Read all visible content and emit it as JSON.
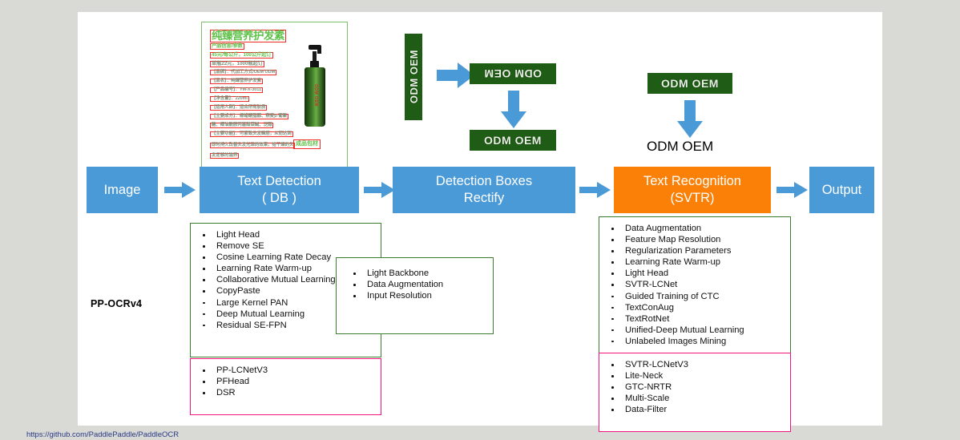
{
  "slide": {
    "pipeline_label": "PP-OCRv4",
    "stages": [
      {
        "id": "image",
        "label_line1": "Image",
        "label_line2": "",
        "color": "#4a9ad7"
      },
      {
        "id": "detection",
        "label_line1": "Text Detection",
        "label_line2": "( DB )",
        "color": "#4a9ad7"
      },
      {
        "id": "rectify",
        "label_line1": "Detection Boxes",
        "label_line2": "Rectify",
        "color": "#4a9ad7"
      },
      {
        "id": "recognition",
        "label_line1": "Text Recognition",
        "label_line2": "(SVTR)",
        "color": "#fa8008"
      },
      {
        "id": "output",
        "label_line1": "Output",
        "label_line2": "",
        "color": "#4a9ad7"
      }
    ],
    "detection_features": {
      "border_color": "#3a7d2c",
      "items": [
        "Light Head",
        "Remove SE",
        "Cosine Learning Rate Decay",
        "Learning Rate Warm-up",
        "Collaborative Mutual Learning",
        "CopyPaste",
        "Large Kernel PAN",
        "Deep Mutual Learning",
        "Residual SE-FPN"
      ]
    },
    "detection_new": {
      "border_color": "#f5147f",
      "items": [
        "PP-LCNetV3",
        "PFHead",
        "DSR"
      ]
    },
    "rectify_features": {
      "border_color": "#3a7d2c",
      "items": [
        "Light Backbone",
        "Data Augmentation",
        "Input Resolution"
      ]
    },
    "recognition_features": {
      "border_color": "#3a7d2c",
      "items": [
        "Data Augmentation",
        "Feature Map Resolution",
        "Regularization Parameters",
        "Learning Rate Warm-up",
        "Light Head",
        "SVTR-LCNet",
        "Guided Training of CTC",
        "TextConAug",
        "TextRotNet",
        "Unified-Deep Mutual Learning",
        "Unlabeled Images Mining"
      ]
    },
    "recognition_new": {
      "border_color": "#f5147f",
      "items": [
        "SVTR-LCNetV3",
        "Lite-Neck",
        "GTC-NRTR",
        "Multi-Scale",
        "Data-Filter"
      ]
    },
    "sample_image": {
      "title": "纯臻营养护发素",
      "bottle_label": "ODM OEM",
      "package_tag": "成品包材",
      "detected_lines": [
        "产品信息/参数",
        "45元/每公斤，100公斤起订",
        "单瓶22元，1000瓶起订",
        "【品牌】：代加工方式/OEM ODM",
        "【品名】：纯臻营养护发素",
        "【产品编号】：YM-X-3011",
        "【净含量】：220ml",
        "【适用人群】：适合所有肤质",
        "【主要成分】：鲸蜡硬脂醇、燕麦β-葡聚",
        "糖、椰油酰胺丙基甜菜碱、泛醇",
        "【主要功能】：可紧致头发磷层，从而达到",
        "即时持久改善头发光泽的效果，给干燥的头",
        "发足够的滋养"
      ]
    },
    "rectify_demo": {
      "vertical_crop": "ODM OEM",
      "flipped_crop": "ODM OEM",
      "corrected_crop": "ODM OEM"
    },
    "recognition_demo": {
      "input_crop": "ODM OEM",
      "output_text": "ODM OEM"
    }
  },
  "arrow_color": "#4a9ad7",
  "footnote": "https://github.com/PaddlePaddle/PaddleOCR"
}
